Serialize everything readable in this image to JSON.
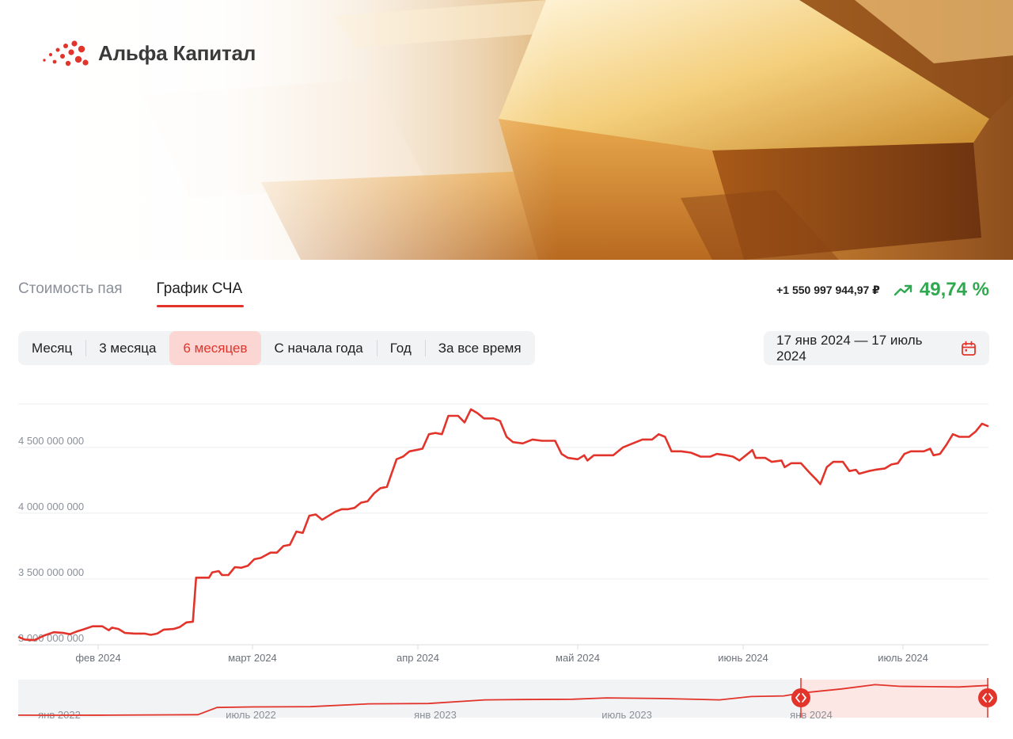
{
  "brand": {
    "name": "Альфа Капитал",
    "accent": "#e2342b"
  },
  "tabs": [
    {
      "label": "Стоимость пая",
      "active": false
    },
    {
      "label": "График СЧА",
      "active": true
    }
  ],
  "summary": {
    "change_abs": "+1 550 997 944,97 ₽",
    "change_pct": "49,74 %",
    "trend_icon": "trend-up-icon",
    "positive_color": "#2fa84f"
  },
  "periods": [
    {
      "label": "Месяц",
      "active": false
    },
    {
      "label": "3 месяца",
      "active": false
    },
    {
      "label": "6 месяцев",
      "active": true
    },
    {
      "label": "С начала года",
      "active": false
    },
    {
      "label": "Год",
      "active": false
    },
    {
      "label": "За все время",
      "active": false
    }
  ],
  "date_range": {
    "label": "17 янв 2024 — 17 июль 2024",
    "icon": "calendar-icon"
  },
  "chart_data": [
    {
      "type": "line",
      "name": "main",
      "ylim": [
        3000000000,
        4850000000
      ],
      "y_ticks": [
        {
          "value": 3000000000,
          "label": "3 000 000 000"
        },
        {
          "value": 3500000000,
          "label": "3 500 000 000"
        },
        {
          "value": 4000000000,
          "label": "4 000 000 000"
        },
        {
          "value": 4500000000,
          "label": "4 500 000 000"
        }
      ],
      "x_range": [
        "2024-01-17",
        "2024-07-17"
      ],
      "x_ticks": [
        {
          "date": "2024-02-01",
          "label": "фев 2024"
        },
        {
          "date": "2024-03-01",
          "label": "март 2024"
        },
        {
          "date": "2024-04-01",
          "label": "апр 2024"
        },
        {
          "date": "2024-05-01",
          "label": "май 2024"
        },
        {
          "date": "2024-06-01",
          "label": "июнь 2024"
        },
        {
          "date": "2024-07-01",
          "label": "июль 2024"
        }
      ],
      "color": "#e2342b",
      "points": [
        [
          "2024-01-17",
          3060000000
        ],
        [
          "2024-01-19",
          3040000000
        ],
        [
          "2024-01-22",
          3035000000
        ],
        [
          "2024-01-25",
          3070000000
        ],
        [
          "2024-01-28",
          3095000000
        ],
        [
          "2024-01-31",
          3090000000
        ],
        [
          "2024-02-02",
          3080000000
        ],
        [
          "2024-02-04",
          3100000000
        ],
        [
          "2024-02-06",
          3115000000
        ],
        [
          "2024-02-09",
          3140000000
        ],
        [
          "2024-02-12",
          3140000000
        ],
        [
          "2024-02-14",
          3110000000
        ],
        [
          "2024-02-15",
          3130000000
        ],
        [
          "2024-02-17",
          3120000000
        ],
        [
          "2024-02-19",
          3090000000
        ],
        [
          "2024-02-22",
          3085000000
        ],
        [
          "2024-02-25",
          3085000000
        ],
        [
          "2024-02-27",
          3075000000
        ],
        [
          "2024-02-29",
          3085000000
        ],
        [
          "2024-03-02",
          3115000000
        ],
        [
          "2024-03-05",
          3120000000
        ],
        [
          "2024-03-07",
          3135000000
        ],
        [
          "2024-03-09",
          3170000000
        ],
        [
          "2024-03-11",
          3175000000
        ],
        [
          "2024-03-12",
          3510000000
        ],
        [
          "2024-03-16",
          3510000000
        ],
        [
          "2024-03-17",
          3550000000
        ],
        [
          "2024-03-19",
          3560000000
        ],
        [
          "2024-03-20",
          3530000000
        ],
        [
          "2024-03-22",
          3530000000
        ],
        [
          "2024-03-24",
          3590000000
        ],
        [
          "2024-03-26",
          3585000000
        ],
        [
          "2024-03-28",
          3600000000
        ],
        [
          "2024-03-30",
          3650000000
        ],
        [
          "2024-04-01",
          3660000000
        ],
        [
          "2024-04-04",
          3700000000
        ],
        [
          "2024-04-06",
          3700000000
        ],
        [
          "2024-04-08",
          3750000000
        ],
        [
          "2024-04-10",
          3760000000
        ],
        [
          "2024-04-12",
          3860000000
        ],
        [
          "2024-04-14",
          3850000000
        ],
        [
          "2024-04-16",
          3980000000
        ],
        [
          "2024-04-18",
          3990000000
        ],
        [
          "2024-04-20",
          3950000000
        ],
        [
          "2024-04-22",
          3980000000
        ],
        [
          "2024-04-24",
          4010000000
        ],
        [
          "2024-04-26",
          4030000000
        ],
        [
          "2024-04-28",
          4030000000
        ],
        [
          "2024-04-30",
          4040000000
        ],
        [
          "2024-05-02",
          4080000000
        ],
        [
          "2024-05-04",
          4090000000
        ],
        [
          "2024-05-06",
          4150000000
        ],
        [
          "2024-05-08",
          4190000000
        ],
        [
          "2024-05-10",
          4200000000
        ],
        [
          "2024-05-13",
          4410000000
        ],
        [
          "2024-05-15",
          4430000000
        ],
        [
          "2024-05-17",
          4470000000
        ],
        [
          "2024-05-19",
          4480000000
        ],
        [
          "2024-05-21",
          4490000000
        ],
        [
          "2024-05-23",
          4600000000
        ],
        [
          "2024-05-25",
          4610000000
        ],
        [
          "2024-05-27",
          4600000000
        ],
        [
          "2024-05-29",
          4740000000
        ],
        [
          "2024-06-01",
          4740000000
        ],
        [
          "2024-06-03",
          4690000000
        ],
        [
          "2024-06-05",
          4790000000
        ],
        [
          "2024-06-07",
          4760000000
        ],
        [
          "2024-06-09",
          4720000000
        ],
        [
          "2024-06-12",
          4720000000
        ],
        [
          "2024-06-14",
          4700000000
        ],
        [
          "2024-06-16",
          4580000000
        ],
        [
          "2024-06-18",
          4540000000
        ],
        [
          "2024-06-21",
          4530000000
        ],
        [
          "2024-06-24",
          4560000000
        ],
        [
          "2024-06-27",
          4550000000
        ],
        [
          "2024-06-29",
          4550000000
        ],
        [
          "2024-07-01",
          4550000000
        ],
        [
          "2024-07-03",
          4450000000
        ],
        [
          "2024-07-05",
          4420000000
        ],
        [
          "2024-07-08",
          4410000000
        ],
        [
          "2024-07-10",
          4440000000
        ],
        [
          "2024-07-11",
          4400000000
        ],
        [
          "2024-07-13",
          4440000000
        ],
        [
          "2024-07-16",
          4440000000
        ],
        [
          "2024-07-19",
          4440000000
        ],
        [
          "2024-07-22",
          4500000000
        ],
        [
          "2024-07-25",
          4530000000
        ],
        [
          "2024-07-28",
          4560000000
        ],
        [
          "2024-07-31",
          4560000000
        ],
        [
          "2024-08-02",
          4600000000
        ],
        [
          "2024-08-04",
          4580000000
        ],
        [
          "2024-08-06",
          4470000000
        ],
        [
          "2024-08-09",
          4470000000
        ],
        [
          "2024-08-12",
          4460000000
        ],
        [
          "2024-08-15",
          4430000000
        ],
        [
          "2024-08-18",
          4430000000
        ],
        [
          "2024-08-20",
          4450000000
        ],
        [
          "2024-08-23",
          4440000000
        ],
        [
          "2024-08-25",
          4430000000
        ],
        [
          "2024-08-27",
          4400000000
        ],
        [
          "2024-08-29",
          4440000000
        ],
        [
          "2024-08-31",
          4480000000
        ],
        [
          "2024-09-01",
          4420000000
        ],
        [
          "2024-09-04",
          4420000000
        ],
        [
          "2024-09-06",
          4390000000
        ],
        [
          "2024-09-09",
          4400000000
        ],
        [
          "2024-09-10",
          4350000000
        ],
        [
          "2024-09-12",
          4380000000
        ],
        [
          "2024-09-15",
          4380000000
        ],
        [
          "2024-09-18",
          4300000000
        ],
        [
          "2024-09-20",
          4250000000
        ],
        [
          "2024-09-21",
          4220000000
        ],
        [
          "2024-09-23",
          4350000000
        ],
        [
          "2024-09-25",
          4390000000
        ],
        [
          "2024-09-28",
          4390000000
        ],
        [
          "2024-09-30",
          4320000000
        ],
        [
          "2024-10-02",
          4330000000
        ],
        [
          "2024-10-03",
          4300000000
        ],
        [
          "2024-10-06",
          4320000000
        ],
        [
          "2024-10-08",
          4330000000
        ],
        [
          "2024-10-11",
          4340000000
        ],
        [
          "2024-10-13",
          4370000000
        ],
        [
          "2024-10-15",
          4380000000
        ],
        [
          "2024-10-17",
          4450000000
        ],
        [
          "2024-10-19",
          4470000000
        ],
        [
          "2024-10-23",
          4470000000
        ],
        [
          "2024-10-25",
          4490000000
        ],
        [
          "2024-10-26",
          4440000000
        ],
        [
          "2024-10-28",
          4450000000
        ],
        [
          "2024-10-30",
          4520000000
        ],
        [
          "2024-11-01",
          4600000000
        ],
        [
          "2024-11-03",
          4580000000
        ],
        [
          "2024-11-06",
          4580000000
        ],
        [
          "2024-11-08",
          4620000000
        ],
        [
          "2024-11-10",
          4680000000
        ],
        [
          "2024-11-12",
          4660000000
        ]
      ]
    },
    {
      "type": "line",
      "name": "navigator",
      "x_range": [
        "2021-12-15",
        "2024-09-20"
      ],
      "ylim": [
        0,
        4800000000
      ],
      "x_ticks": [
        {
          "date": "2022-01-01",
          "label": "янв 2022"
        },
        {
          "date": "2022-07-01",
          "label": "июль 2022"
        },
        {
          "date": "2023-01-01",
          "label": "янв 2023"
        },
        {
          "date": "2023-07-01",
          "label": "июль 2023"
        },
        {
          "date": "2024-01-01",
          "label": "янв 2024"
        }
      ],
      "selection": [
        "2024-01-17",
        "2024-09-20"
      ],
      "points": [
        [
          "2021-12-15",
          130000000
        ],
        [
          "2022-01-20",
          125000000
        ],
        [
          "2022-03-20",
          130000000
        ],
        [
          "2022-05-20",
          180000000
        ],
        [
          "2022-06-20",
          210000000
        ],
        [
          "2022-07-10",
          1300000000
        ],
        [
          "2022-08-15",
          1380000000
        ],
        [
          "2022-10-15",
          1420000000
        ],
        [
          "2022-12-15",
          1850000000
        ],
        [
          "2023-02-15",
          1900000000
        ],
        [
          "2023-04-15",
          2450000000
        ],
        [
          "2023-05-20",
          2500000000
        ],
        [
          "2023-07-15",
          2550000000
        ],
        [
          "2023-08-20",
          2750000000
        ],
        [
          "2023-10-15",
          2650000000
        ],
        [
          "2023-12-15",
          2450000000
        ],
        [
          "2024-01-17",
          2950000000
        ],
        [
          "2024-02-20",
          3050000000
        ],
        [
          "2024-03-10",
          3500000000
        ],
        [
          "2024-04-20",
          4100000000
        ],
        [
          "2024-05-25",
          4750000000
        ],
        [
          "2024-06-20",
          4500000000
        ],
        [
          "2024-07-20",
          4450000000
        ],
        [
          "2024-08-20",
          4400000000
        ],
        [
          "2024-09-20",
          4650000000
        ]
      ]
    }
  ]
}
